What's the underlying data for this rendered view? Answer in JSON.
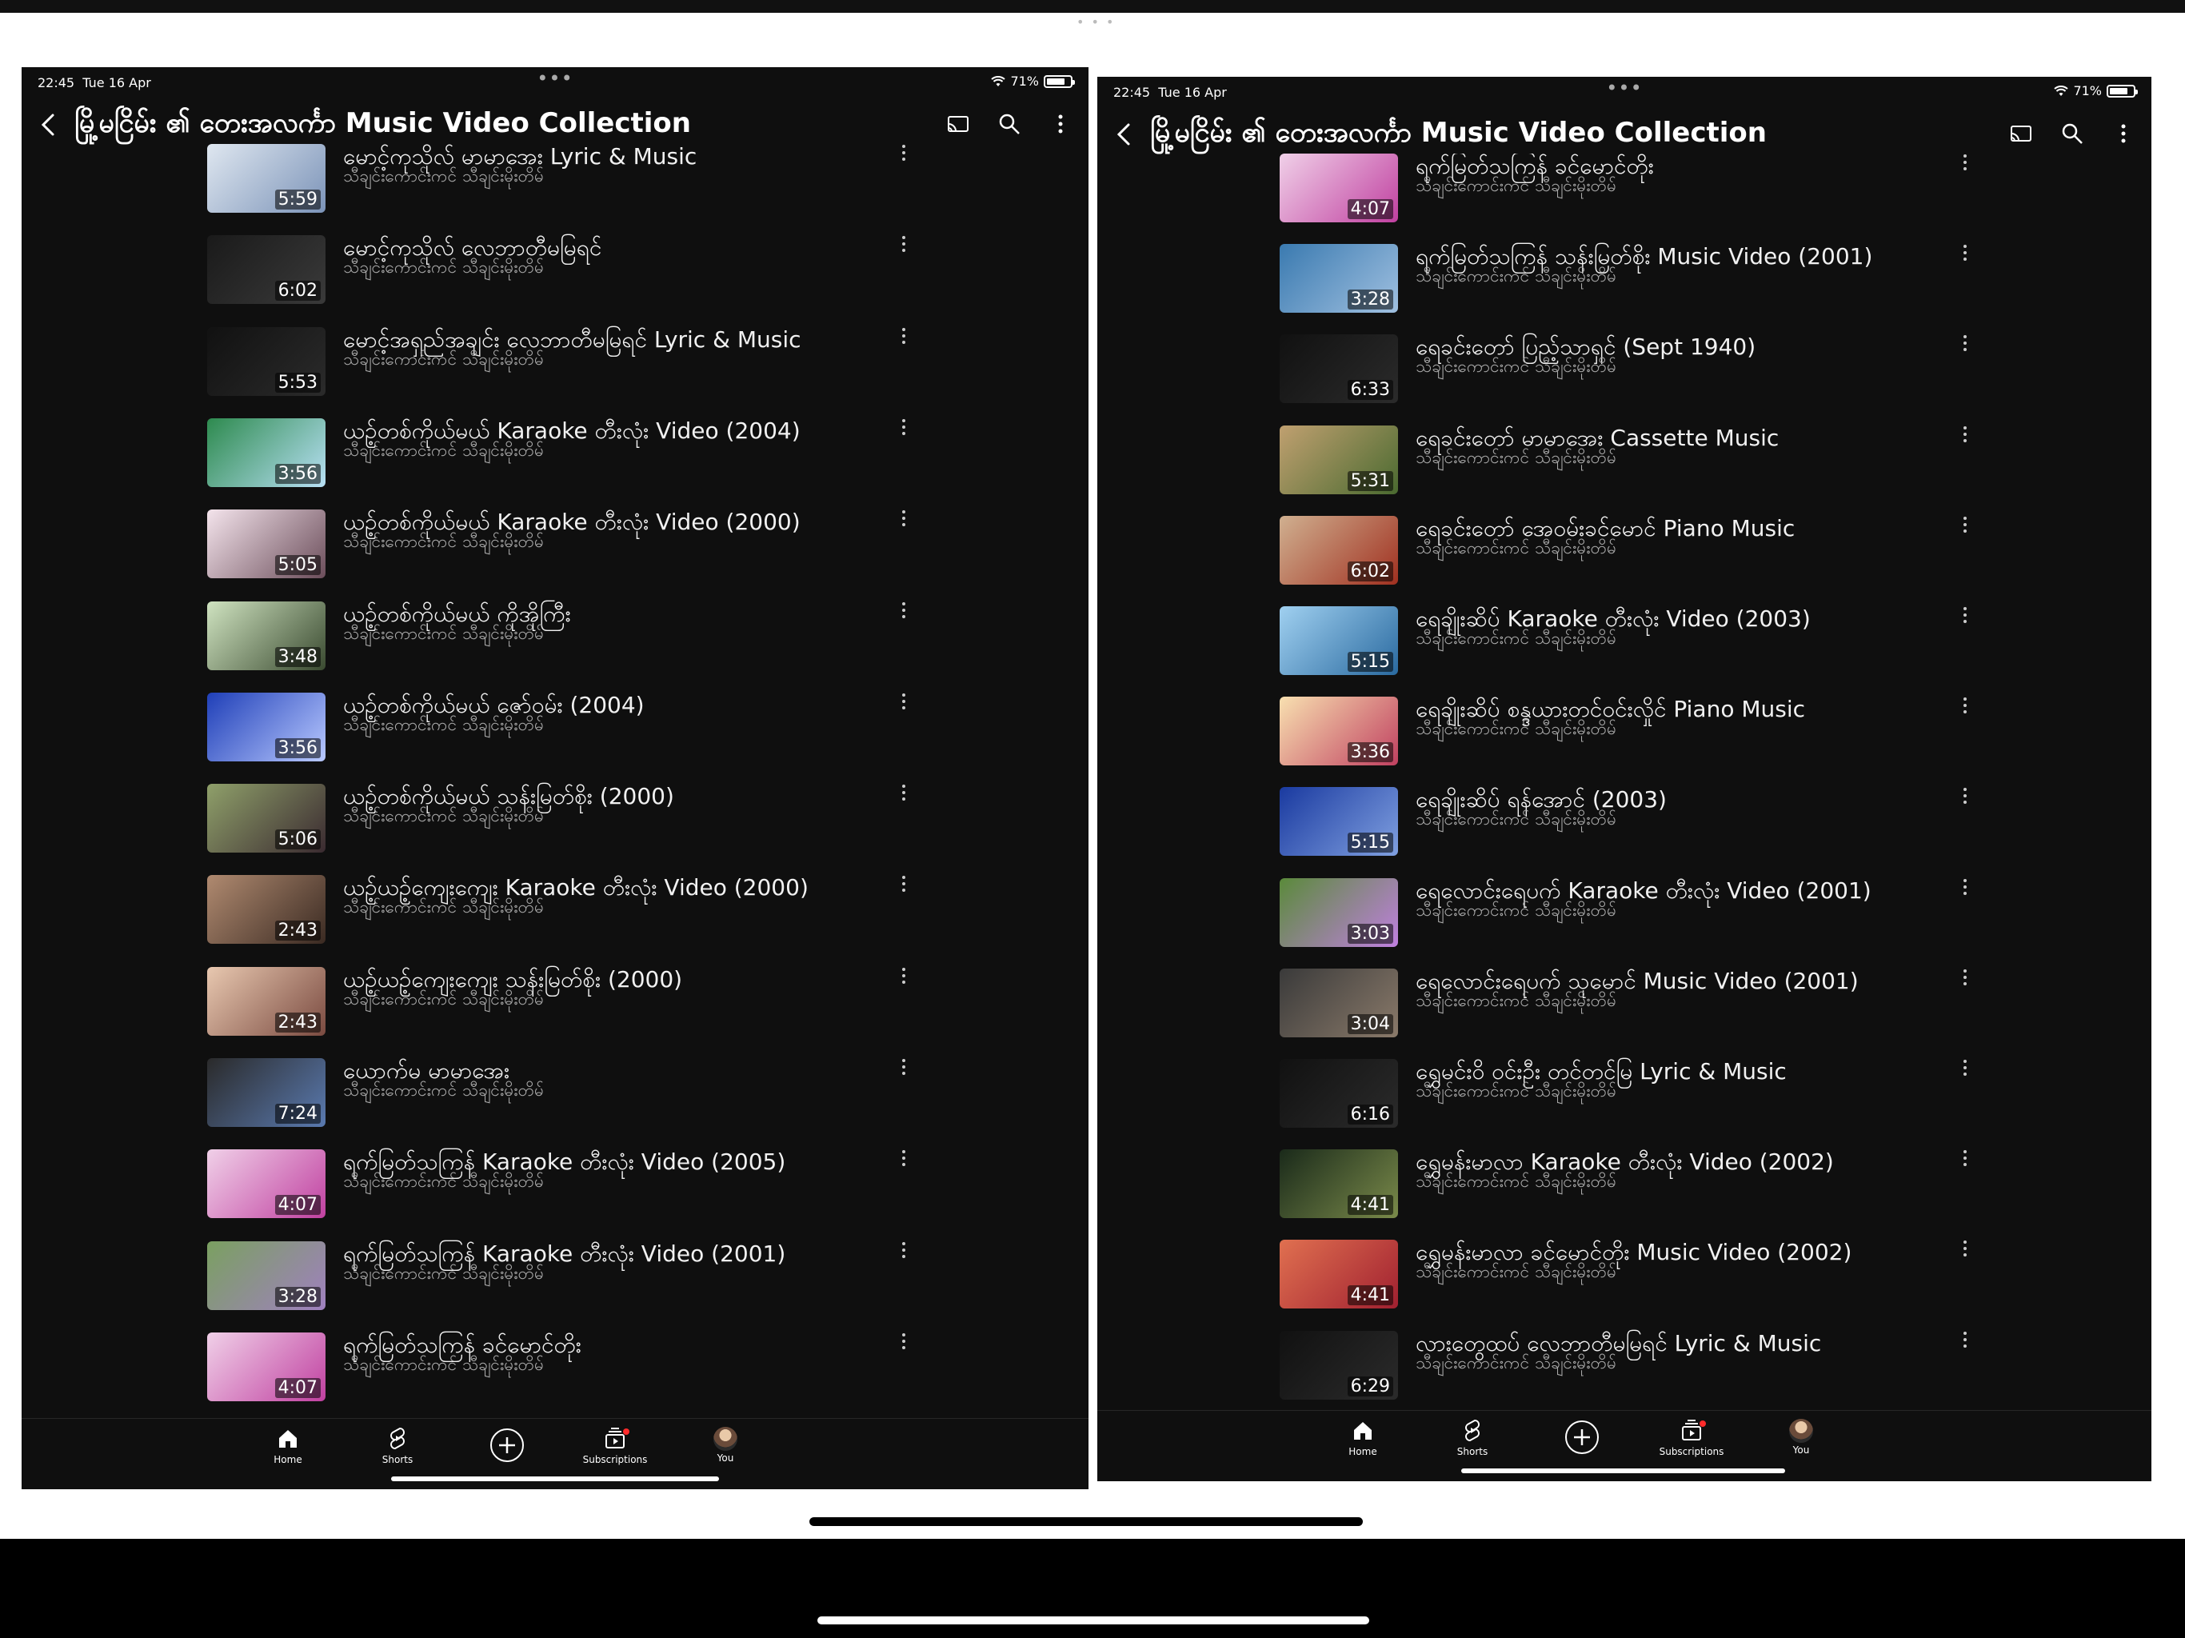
{
  "status": {
    "time": "22:45",
    "date": "Tue 16 Apr",
    "battery": "71%"
  },
  "header": {
    "title": "မြို့မငြိမ်း ၏ တေးအလင်္ကာ Music Video Collection"
  },
  "channel": "သီချင်းကောင်းကင် သီချင်းမိုးတိမ်",
  "nav": {
    "home": "Home",
    "shorts": "Shorts",
    "subscriptions": "Subscriptions",
    "you": "You"
  },
  "colors": {
    "background": "#0f0f0f",
    "text": "#f1f1f1",
    "subtext": "#aaaaaa",
    "notification": "#ff2b2b"
  },
  "left_videos": [
    {
      "title": "မောင့်ကုသိုလ် မာမာအေး Lyric & Music",
      "duration": "5:59"
    },
    {
      "title": "မောင့်ကုသိုလ် လေဘာတီမမြရင်",
      "duration": "6:02"
    },
    {
      "title": "မောင့်အရှည်အချင်း လေဘာတီမမြရင် Lyric & Music",
      "duration": "5:53"
    },
    {
      "title": "ယဥ့်တစ်ကိုယ်မယ် Karaoke တီးလုံး Video (2004)",
      "duration": "3:56"
    },
    {
      "title": "ယဥ့်တစ်ကိုယ်မယ် Karaoke တီးလုံး Video (2000)",
      "duration": "5:05"
    },
    {
      "title": "ယဥ့်တစ်ကိုယ်မယ် ကိုအိုကြီး",
      "duration": "3:48"
    },
    {
      "title": "ယဥ့်တစ်ကိုယ်မယ် ဇော်ဝမ်း (2004)",
      "duration": "3:56"
    },
    {
      "title": "ယဥ့်တစ်ကိုယ်မယ် သန်းမြတ်စိုး (2000)",
      "duration": "5:06"
    },
    {
      "title": "ယဥ့်ယဥ့်ကျေးကျေး Karaoke တီးလုံး Video (2000)",
      "duration": "2:43"
    },
    {
      "title": "ယဥ့်ယဥ့်ကျေးကျေး သန်းမြတ်စိုး (2000)",
      "duration": "2:43"
    },
    {
      "title": "ယောက်မ မာမာအေး",
      "duration": "7:24"
    },
    {
      "title": "ရက်မြတ်သကြန် Karaoke တီးလုံး Video (2005)",
      "duration": "4:07"
    },
    {
      "title": "ရက်မြတ်သကြန် Karaoke တီးလုံး Video (2001)",
      "duration": "3:28"
    },
    {
      "title": "ရက်မြတ်သကြန် ခင်မောင်တိုး",
      "duration": "4:07"
    }
  ],
  "right_videos": [
    {
      "title": "ရက်မြတ်သကြန် ခင်မောင်တိုး",
      "duration": "4:07"
    },
    {
      "title": "ရက်မြတ်သကြန် သန်းမြတ်စိုး Music Video (2001)",
      "duration": "3:28"
    },
    {
      "title": "ရေခင်းတော် ပြည့်သာရှင် (Sept 1940)",
      "duration": "6:33"
    },
    {
      "title": "ရေခင်းတော် မာမာအေး Cassette Music",
      "duration": "5:31"
    },
    {
      "title": "ရေခင်းတော် အေဝမ်းခင်မောင် Piano Music",
      "duration": "6:02"
    },
    {
      "title": "ရေချိုးဆိပ် Karaoke တီးလုံး Video (2003)",
      "duration": "5:15"
    },
    {
      "title": "ရေချိုးဆိပ် စန္ဒယားတင်ဝင်းလှိုင် Piano Music",
      "duration": "3:36"
    },
    {
      "title": "ရေချိုးဆိပ် ရန်အောင် (2003)",
      "duration": "5:15"
    },
    {
      "title": "ရေလောင်းရေပက် Karaoke တီးလုံး Video (2001)",
      "duration": "3:03"
    },
    {
      "title": "ရေလောင်းရေပက် သုမောင် Music Video (2001)",
      "duration": "3:04"
    },
    {
      "title": "ရွှေမင်းဝိ ဝင်းဦး တင်တင်မြ Lyric & Music",
      "duration": "6:16"
    },
    {
      "title": "ရွှေမန်းမာလာ Karaoke တီးလုံး Video (2002)",
      "duration": "4:41"
    },
    {
      "title": "ရွှေမန်းမာလာ ခင်မောင်တိုး Music Video (2002)",
      "duration": "4:41"
    },
    {
      "title": "လားတွေထပ် လေဘာတီမမြရင် Lyric & Music",
      "duration": "6:29"
    }
  ]
}
